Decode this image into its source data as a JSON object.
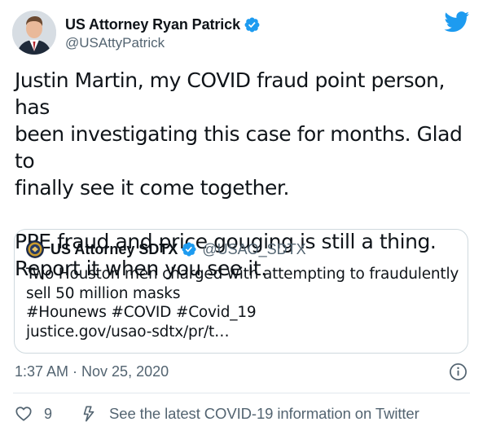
{
  "tweet": {
    "author_name": "US Attorney Ryan Patrick",
    "author_handle": "@USAttyPatrick",
    "paragraphs": [
      "Justin Martin, my COVID fraud point person, has",
      "been investigating this case for months. Glad to",
      "finally see it come together.",
      "",
      "PPE fraud and price gouging is still a thing.",
      "Report it when you see it."
    ],
    "timestamp": "1:37 AM · Nov 25, 2020",
    "like_count": "9",
    "covid_info_text": "See the latest COVID-19 information on Twitter"
  },
  "quote": {
    "author_name": "US Attorney SDTX",
    "author_handle": "@USAO_SDTX",
    "lines": [
      "Two Houston men charged with attempting to fraudulently",
      "sell 50 million masks",
      "#Hounews #COVID #Covid_19",
      "justice.gov/usao-sdtx/pr/t…"
    ]
  },
  "icons": {
    "verified": "verified-badge-icon",
    "brand": "twitter-bird-icon",
    "info": "info-icon",
    "like": "heart-icon",
    "covid": "bolt-icon"
  },
  "colors": {
    "brand_blue": "#1d9bf0",
    "text_primary": "#0f1419",
    "text_secondary": "#536471",
    "border": "#cfd9de"
  }
}
